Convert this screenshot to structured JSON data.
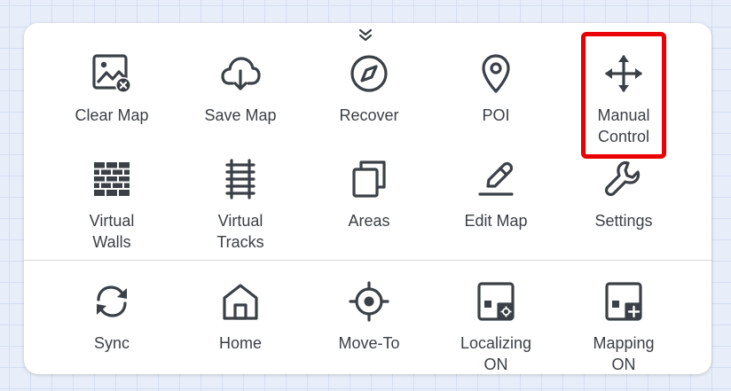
{
  "colors": {
    "icon": "#3b4047",
    "label": "#3a3f45",
    "highlight": "#ea0000",
    "panel": "#ffffff"
  },
  "row1": [
    {
      "label": "Clear Map",
      "icon": "clear-map-icon"
    },
    {
      "label": "Save Map",
      "icon": "cloud-download-icon"
    },
    {
      "label": "Recover",
      "icon": "compass-icon"
    },
    {
      "label": "POI",
      "icon": "location-pin-icon"
    },
    {
      "label": "Manual\nControl",
      "icon": "move-arrows-icon",
      "highlighted": true
    }
  ],
  "row2": [
    {
      "label": "Virtual\nWalls",
      "icon": "brick-wall-icon"
    },
    {
      "label": "Virtual\nTracks",
      "icon": "track-icon"
    },
    {
      "label": "Areas",
      "icon": "stacked-squares-icon"
    },
    {
      "label": "Edit Map",
      "icon": "pencil-icon"
    },
    {
      "label": "Settings",
      "icon": "wrench-icon"
    }
  ],
  "row3": [
    {
      "label": "Sync",
      "icon": "sync-icon"
    },
    {
      "label": "Home",
      "icon": "home-icon"
    },
    {
      "label": "Move-To",
      "icon": "crosshair-icon"
    },
    {
      "label": "Localizing\nON",
      "icon": "localizing-map-icon"
    },
    {
      "label": "Mapping\nON",
      "icon": "mapping-add-icon"
    }
  ]
}
